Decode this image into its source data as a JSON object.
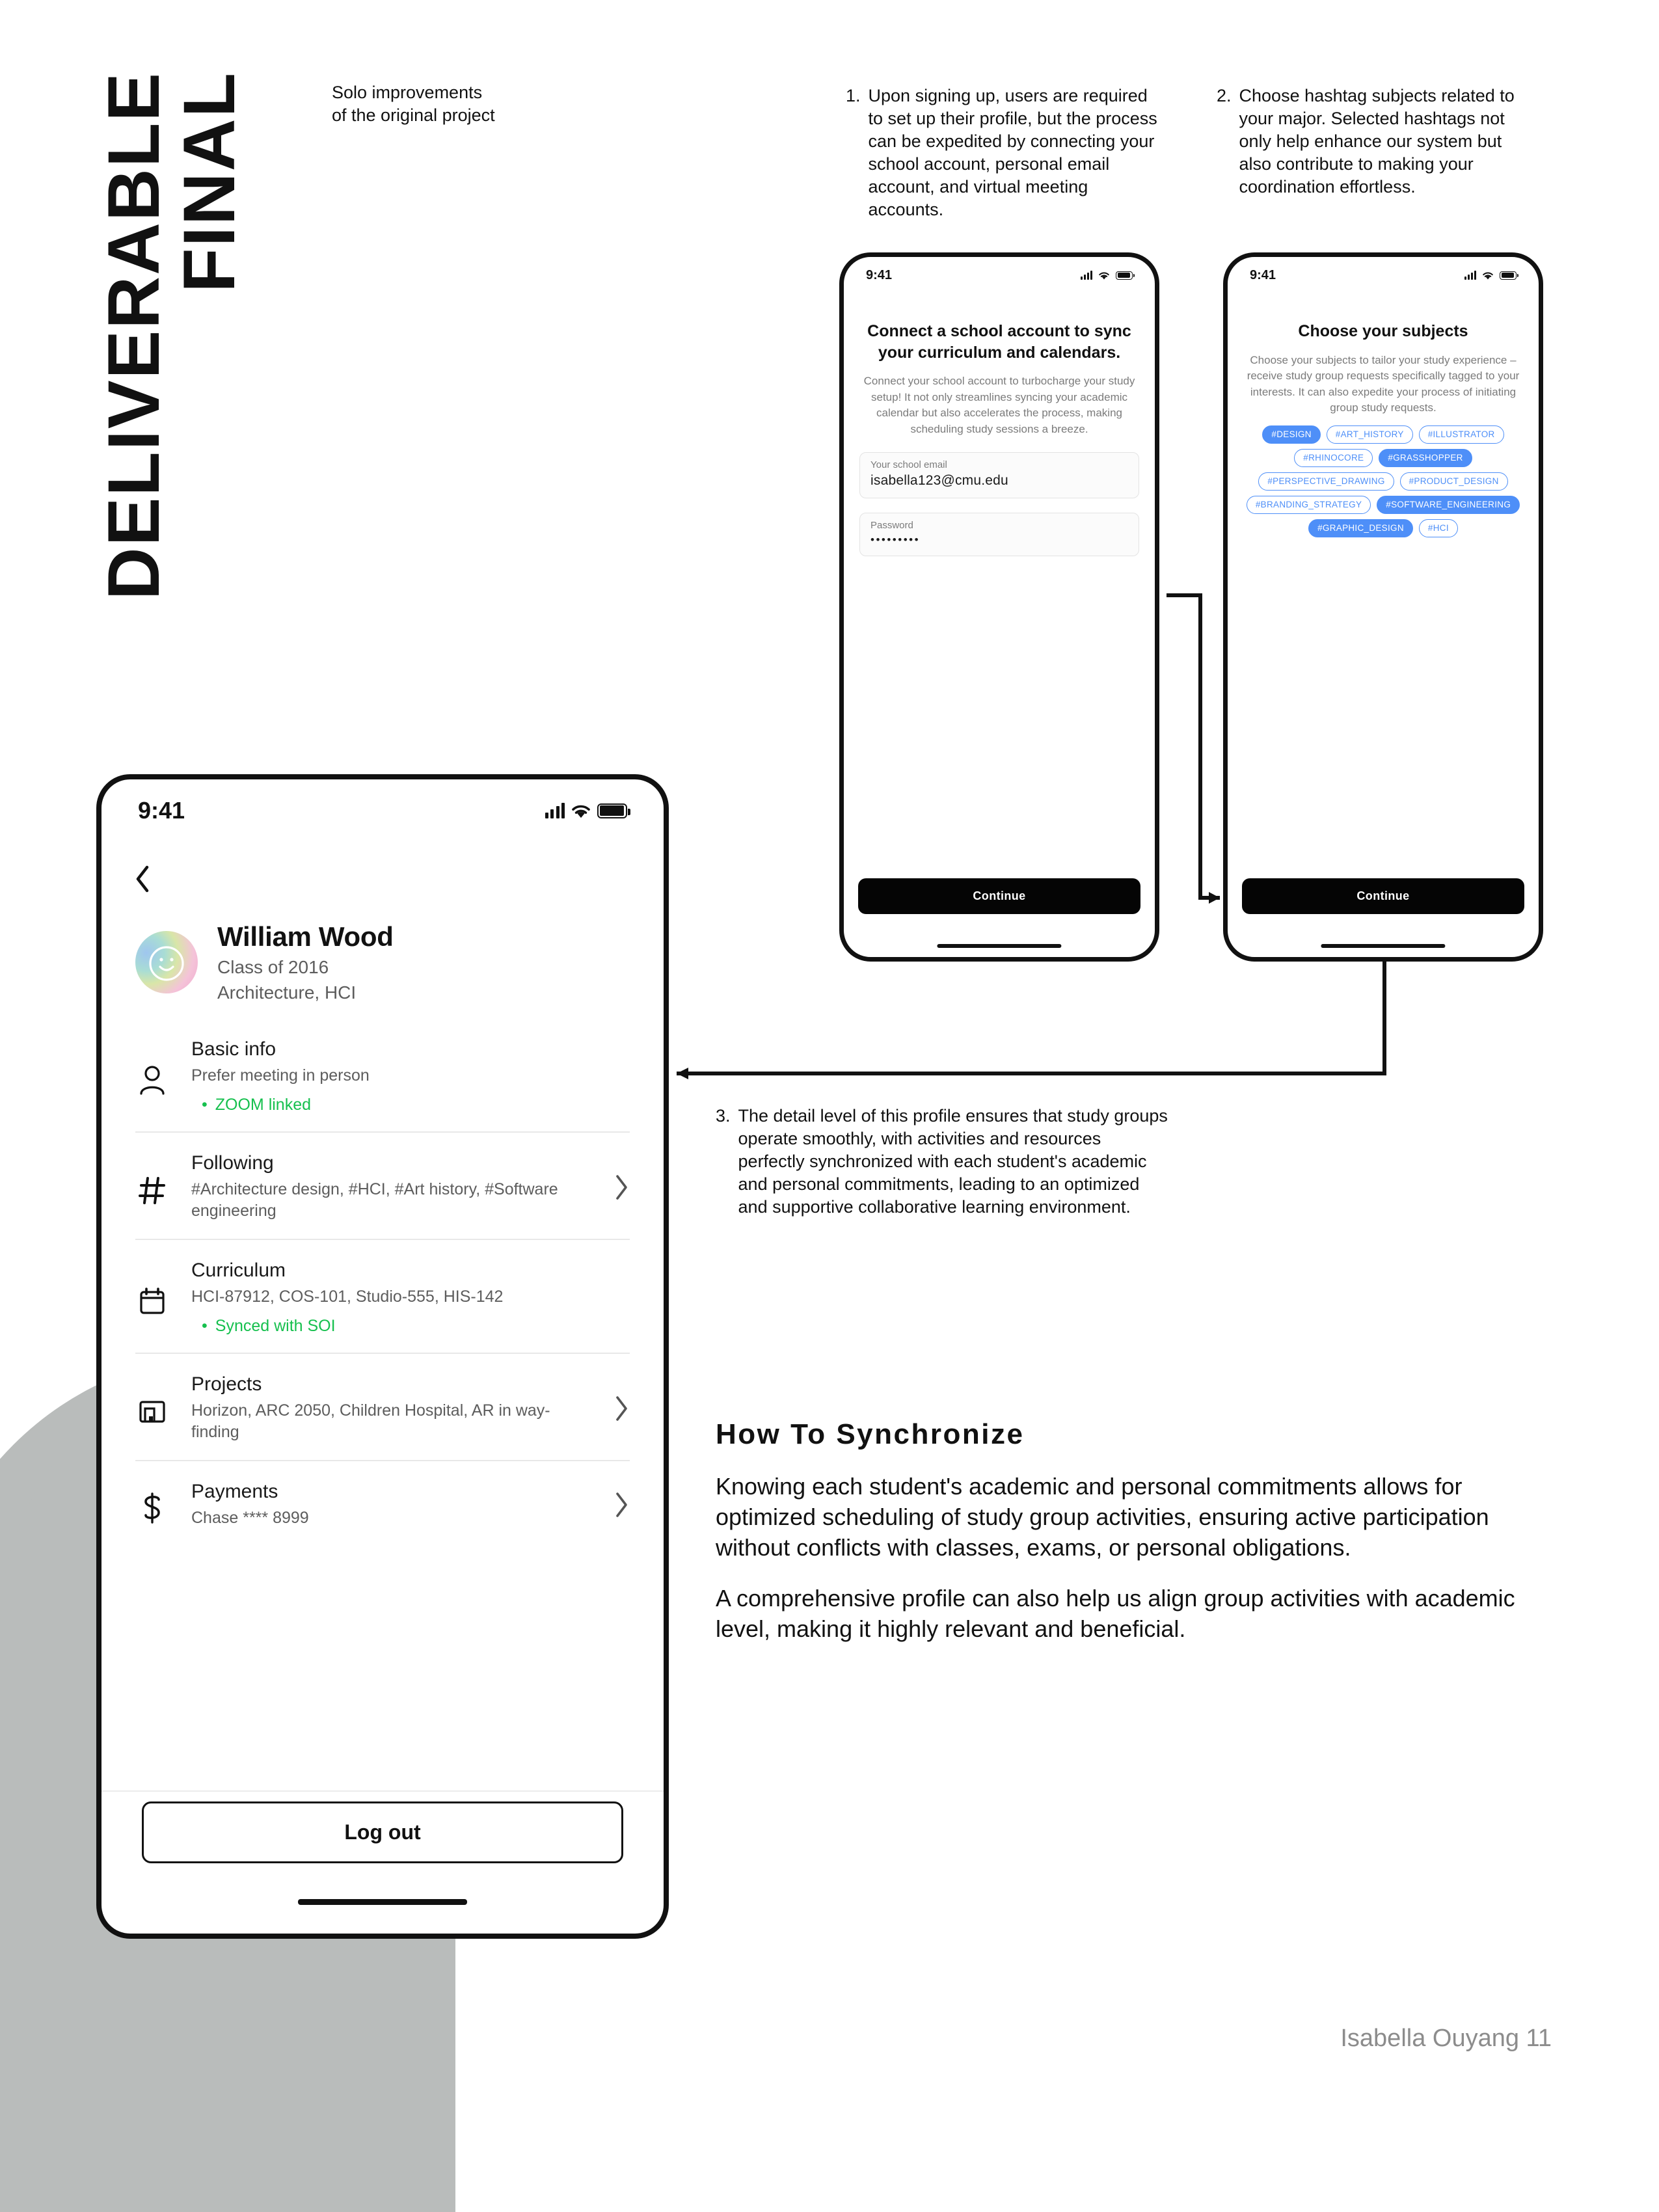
{
  "title": {
    "line1": "FINAL",
    "line2": "DELIVERABLE"
  },
  "subtitle": "Solo improvements\nof the original project",
  "notes": [
    {
      "num": "1.",
      "text": "Upon signing up, users are required to set up their profile, but the process can be expedited by connecting your school account, personal email account, and virtual meeting accounts."
    },
    {
      "num": "2.",
      "text": "Choose hashtag subjects related to your major. Selected hashtags not only help enhance our system but also contribute to making your coordination effortless."
    },
    {
      "num": "3.",
      "text": "The detail level of this profile ensures that study groups operate smoothly, with activities and resources perfectly synchronized with each student's academic and personal commitments, leading to an optimized and supportive collaborative learning environment."
    }
  ],
  "phone1": {
    "status_time": "9:41",
    "title": "Connect a school account to sync your curriculum and calendars.",
    "description": "Connect your school account to turbocharge your study setup! It not only streamlines syncing your academic calendar but also accelerates the process, making scheduling study sessions a breeze.",
    "email_label": "Your school email",
    "email_value": "isabella123@cmu.edu",
    "password_label": "Password",
    "password_value": "•••••••••",
    "cta": "Continue"
  },
  "phone2": {
    "status_time": "9:41",
    "title": "Choose your subjects",
    "description": "Choose your subjects to tailor your study experience – receive study group requests specifically tagged to your interests. It can also expedite your process of initiating group study requests.",
    "chips": [
      {
        "label": "#DESIGN",
        "selected": true
      },
      {
        "label": "#ART_HISTORY",
        "selected": false
      },
      {
        "label": "#ILLUSTRATOR",
        "selected": false
      },
      {
        "label": "#RHINOCORE",
        "selected": false
      },
      {
        "label": "#GRASSHOPPER",
        "selected": true
      },
      {
        "label": "#PERSPECTIVE_DRAWING",
        "selected": false
      },
      {
        "label": "#PRODUCT_DESIGN",
        "selected": false
      },
      {
        "label": "#BRANDING_STRATEGY",
        "selected": false
      },
      {
        "label": "#SOFTWARE_ENGINEERING",
        "selected": true
      },
      {
        "label": "#GRAPHIC_DESIGN",
        "selected": true
      },
      {
        "label": "#HCI",
        "selected": false
      }
    ],
    "cta": "Continue"
  },
  "profile": {
    "status_time": "9:41",
    "name": "William Wood",
    "class": "Class of 2016",
    "major": "Architecture, HCI",
    "rows": [
      {
        "icon": "person-icon",
        "title": "Basic info",
        "sub": "Prefer meeting in person",
        "green": "ZOOM linked",
        "chevron": false
      },
      {
        "icon": "hash-icon",
        "title": "Following",
        "sub": "#Architecture design, #HCI, #Art history, #Software engineering",
        "green": "",
        "chevron": true
      },
      {
        "icon": "calendar-icon",
        "title": "Curriculum",
        "sub": "HCI-87912, COS-101, Studio-555, HIS-142",
        "green": "Synced with SOI",
        "chevron": false
      },
      {
        "icon": "projects-icon",
        "title": "Projects",
        "sub": "Horizon, ARC 2050, Children Hospital, AR in way-finding",
        "green": "",
        "chevron": true
      },
      {
        "icon": "dollar-icon",
        "title": "Payments",
        "sub": "Chase **** 8999",
        "green": "",
        "chevron": true
      }
    ],
    "logout": "Log out"
  },
  "how_to": {
    "heading": "How To Synchronize",
    "p1": "Knowing each student's academic and personal commitments allows for optimized scheduling of study group activities, ensuring active participation without conflicts with classes, exams, or personal obligations.",
    "p2": "A comprehensive profile can also help us align group activities with academic level, making it highly relevant and beneficial."
  },
  "footer": "Isabella Ouyang 11",
  "colors": {
    "chip_blue": "#4e8ff8",
    "green": "#16c04e",
    "gray_shape": "#b9bcbb"
  }
}
